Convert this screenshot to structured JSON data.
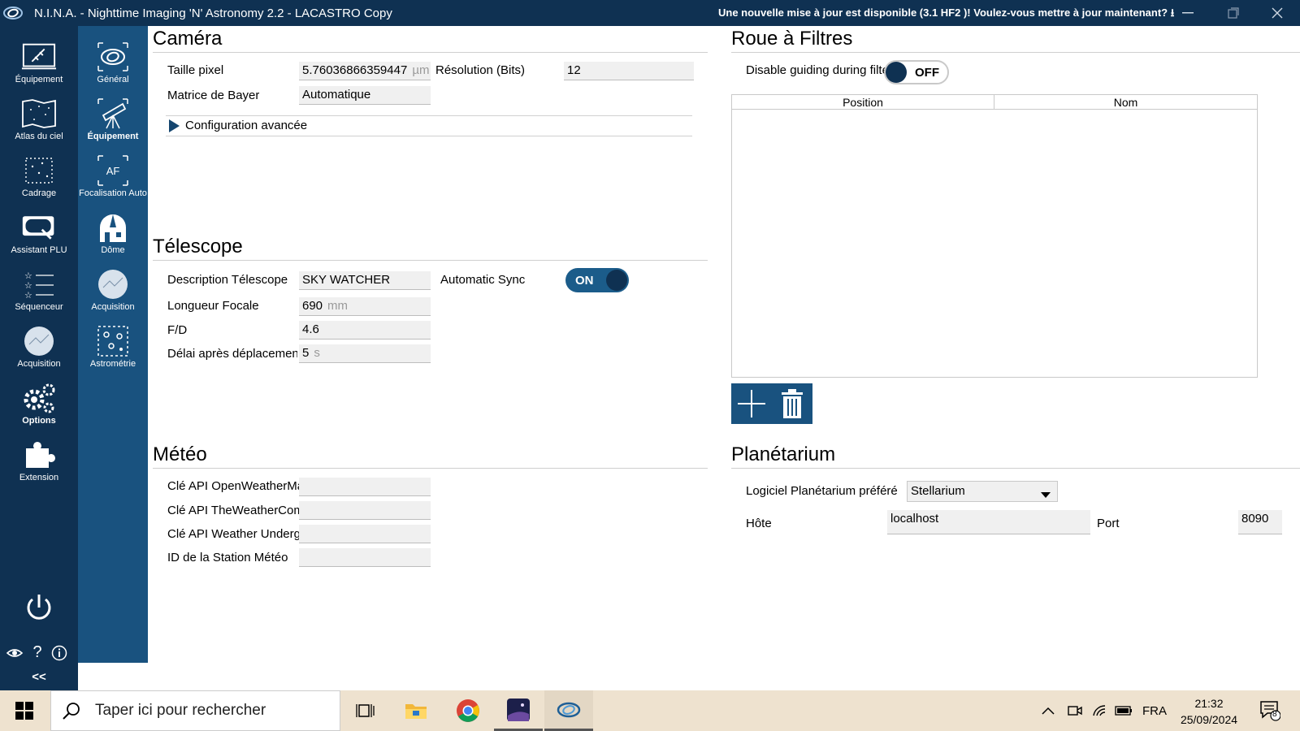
{
  "titlebar": {
    "title": "N.I.N.A. - Nighttime Imaging 'N' Astronomy 2.2   -  LACASTRO Copy",
    "update_notice": "Une nouvelle mise à jour est disponible (3.1 HF2 )! Voulez-vous mettre à jour maintenant?"
  },
  "sidebar": {
    "items": [
      {
        "label": "Équipement",
        "icon": "plug-icon"
      },
      {
        "label": "Atlas du ciel",
        "icon": "sky-map-icon"
      },
      {
        "label": "Cadrage",
        "icon": "framing-icon"
      },
      {
        "label": "Assistant PLU",
        "icon": "flat-wizard-icon"
      },
      {
        "label": "Séquenceur",
        "icon": "sequencer-icon"
      },
      {
        "label": "Acquisition",
        "icon": "imaging-icon"
      },
      {
        "label": "Options",
        "icon": "gears-icon"
      },
      {
        "label": "Extension",
        "icon": "puzzle-icon"
      }
    ],
    "collapse_label": "<<"
  },
  "subnav": {
    "items": [
      {
        "label": "Général",
        "icon": "nina-logo-icon"
      },
      {
        "label": "Équipement",
        "icon": "telescope-icon"
      },
      {
        "label": "Focalisation Auto",
        "icon": "autofocus-icon",
        "glyph": "AF"
      },
      {
        "label": "Dôme",
        "icon": "dome-icon"
      },
      {
        "label": "Acquisition",
        "icon": "imaging-icon"
      },
      {
        "label": "Astrométrie",
        "icon": "plate-solve-icon"
      }
    ]
  },
  "camera": {
    "heading": "Caméra",
    "pixel_size_label": "Taille pixel",
    "pixel_size_value": "5.76036866359447",
    "pixel_size_unit": "µm",
    "resolution_label": "Résolution (Bits)",
    "resolution_value": "12",
    "bayer_label": "Matrice de Bayer",
    "bayer_value": "Automatique",
    "advanced_label": "Configuration avancée"
  },
  "telescope": {
    "heading": "Télescope",
    "description_label": "Description Télescope",
    "description_value": "SKY WATCHER",
    "sync_label": "Automatic Sync",
    "sync_state": "ON",
    "focal_label": "Longueur Focale",
    "focal_value": "690",
    "focal_unit": "mm",
    "fd_label": "F/D",
    "fd_value": "4.6",
    "delay_label": "Délai après déplacement",
    "delay_value": "5",
    "delay_unit": "s"
  },
  "weather": {
    "heading": "Météo",
    "owm_label": "Clé API OpenWeatherMap",
    "twc_label": "Clé API TheWeatherCompany",
    "wu_label": "Clé API Weather Underground",
    "station_label": "ID de la Station Météo",
    "owm_value": "",
    "twc_value": "",
    "wu_value": "",
    "station_value": ""
  },
  "filterwheel": {
    "heading": "Roue à Filtres",
    "guiding_label": "Disable guiding during filter change",
    "guiding_state": "OFF",
    "columns": [
      "Position",
      "Nom"
    ]
  },
  "planetarium": {
    "heading": "Planétarium",
    "software_label": "Logiciel Planétarium préféré",
    "software_value": "Stellarium",
    "host_label": "Hôte",
    "host_value": "localhost",
    "port_label": "Port",
    "port_value": "8090"
  },
  "taskbar": {
    "search_placeholder": "Taper ici pour rechercher",
    "lang": "FRA",
    "time": "21:32",
    "date": "25/09/2024",
    "notif_count": "8"
  },
  "colors": {
    "nav_dark": "#0f3152",
    "nav_mid": "#19527f",
    "toggle_on": "#1b5c8a",
    "taskbar": "#eee2cf"
  }
}
